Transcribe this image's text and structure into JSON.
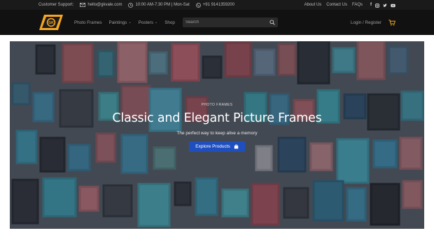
{
  "topbar": {
    "support_label": "Customer Support:",
    "email": "hello@gkvale.com",
    "hours": "10:00 AM-7:30 PM  |  Mon-Sat",
    "phone": "+91 9141359200",
    "links": [
      "About Us",
      "Contact Us",
      "FAQs"
    ],
    "social_icons": [
      "facebook-icon",
      "instagram-icon",
      "twitter-icon",
      "youtube-icon"
    ]
  },
  "nav": {
    "menu": [
      {
        "label": "Photo Frames",
        "dropdown": false
      },
      {
        "label": "Paintings",
        "dropdown": true
      },
      {
        "label": "Posters",
        "dropdown": true
      },
      {
        "label": "Shop",
        "dropdown": false
      }
    ],
    "search_placeholder": "Search",
    "login_label": "Login / Register"
  },
  "hero": {
    "eyebrow": "PHOTO FRAMES",
    "headline": "Classic and Elegant Picture Frames",
    "subheadline": "The perfect way to keep alive a memory",
    "cta_label": "Explore Products"
  },
  "colors": {
    "topbar_bg": "#1a1a1a",
    "nav_bg": "#111111",
    "logo_accent": "#f5a623",
    "cta_bg": "#1f4fbf",
    "cart_icon": "#f5a623"
  }
}
